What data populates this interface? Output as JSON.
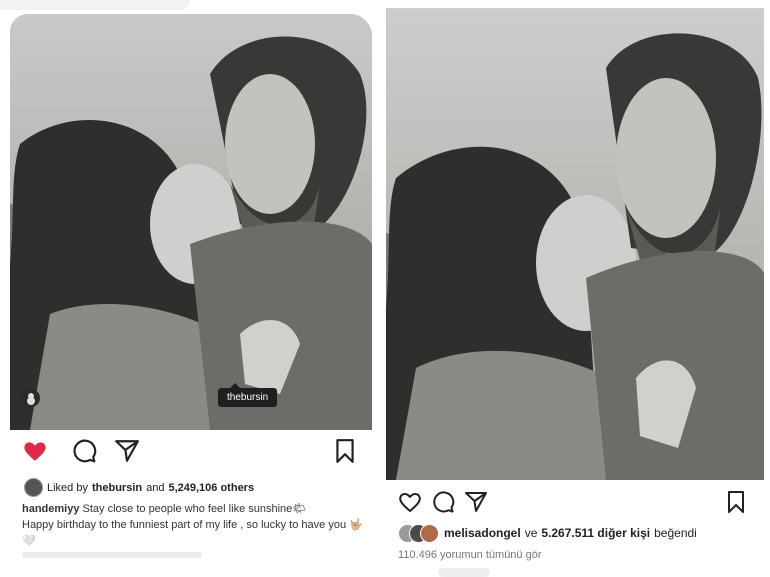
{
  "left_post": {
    "tag_label": "thebursin",
    "liked_by_prefix": "Liked by",
    "liked_by_user": "thebursin",
    "liked_by_and": "and",
    "liked_by_count": "5,249,106 others",
    "caption_user": "handemiyy",
    "caption_text_1": "Stay close to people who feel like sunshine🌤",
    "caption_text_2": "Happy birthday to the funniest part of my life , so lucky to have you 🤟🏼🤍",
    "icons": [
      "heart-filled-icon",
      "comment-icon",
      "share-icon",
      "bookmark-icon"
    ],
    "heart_color": "#e0294a"
  },
  "right_post": {
    "likes_user": "melisadongel",
    "likes_conj": "ve",
    "likes_count": "5.267.511 diğer kişi",
    "likes_suffix": "beğendi",
    "comments_text": "110.496 yorumun tümünü gör",
    "icons": [
      "heart-outline-icon",
      "comment-icon",
      "share-icon",
      "bookmark-icon"
    ]
  }
}
